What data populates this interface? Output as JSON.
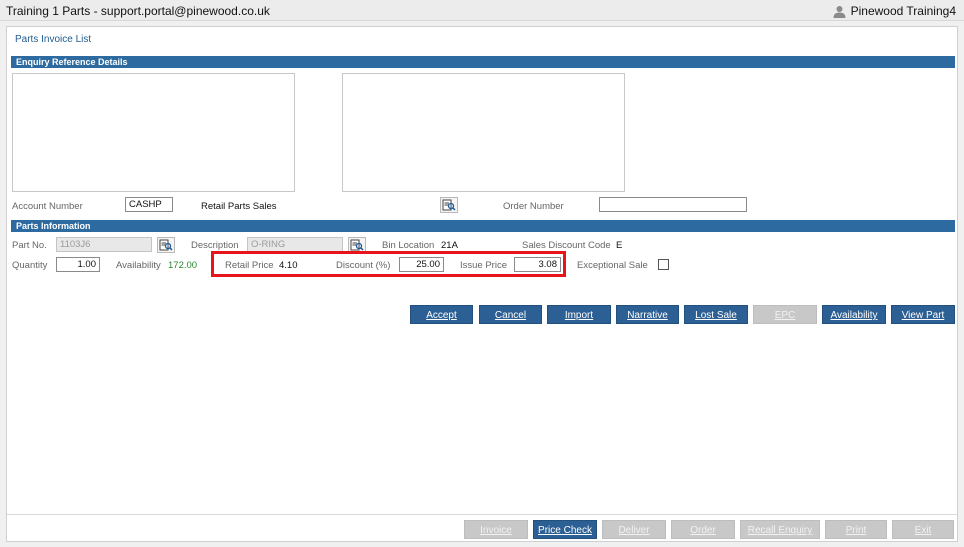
{
  "titlebar": {
    "title": "Training 1 Parts - support.portal@pinewood.co.uk",
    "user_name": "Pinewood Training4"
  },
  "page": {
    "title": "Parts Invoice List"
  },
  "enquiry": {
    "section_title": "Enquiry Reference Details",
    "account_number_label": "Account Number",
    "account_number_value": "CASHP",
    "account_name": "Retail Parts Sales",
    "order_number_label": "Order Number",
    "order_number_value": ""
  },
  "parts": {
    "section_title": "Parts Information",
    "part_no_label": "Part No.",
    "part_no_value": "1103J6",
    "description_label": "Description",
    "description_value": "O-RING",
    "bin_location_label": "Bin Location",
    "bin_location_value": "21A",
    "sales_discount_code_label": "Sales Discount Code",
    "sales_discount_code_value": "E",
    "quantity_label": "Quantity",
    "quantity_value": "1.00",
    "availability_label": "Availability",
    "availability_value": "172.00",
    "retail_price_label": "Retail Price",
    "retail_price_value": "4.10",
    "discount_label": "Discount (%)",
    "discount_value": "25.00",
    "issue_price_label": "Issue Price",
    "issue_price_value": "3.08",
    "exceptional_sale_label": "Exceptional Sale"
  },
  "actions": {
    "accept": "Accept",
    "cancel": "Cancel",
    "import": "Import",
    "narrative": "Narrative",
    "lost_sale": "Lost Sale",
    "epc": "EPC",
    "availability": "Availability",
    "view_part": "View Part"
  },
  "footer": {
    "invoice": "Invoice",
    "price_check": "Price Check",
    "deliver": "Deliver",
    "order": "Order",
    "recall_enquiry": "Recall Enquiry",
    "print": "Print",
    "exit": "Exit"
  },
  "colors": {
    "accent": "#2c5f93",
    "section_bar": "#2c6aa0",
    "highlight": "#e8141b",
    "availability": "#2a8a2a"
  }
}
